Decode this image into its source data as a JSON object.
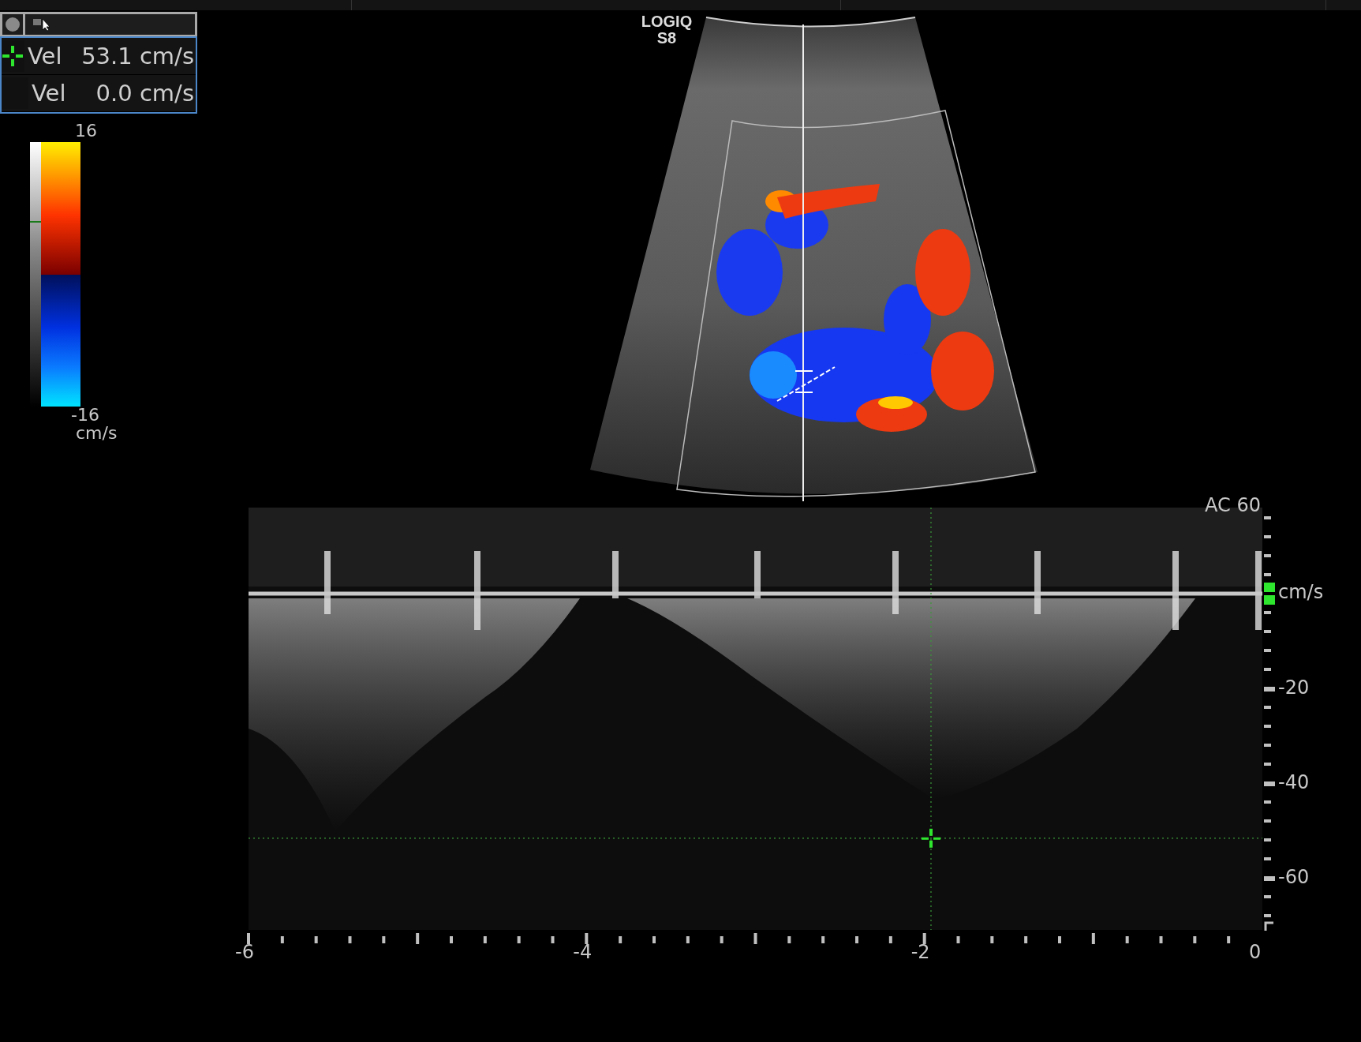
{
  "measurements": [
    {
      "label": "Vel",
      "value": "53.1 cm/s",
      "marker": true
    },
    {
      "label": "Vel",
      "value": "0.0 cm/s",
      "marker": false
    }
  ],
  "color_scale": {
    "max": "16",
    "min": "-16",
    "unit": "cm/s"
  },
  "system_label": {
    "line_1": "LOGIQ",
    "line_2": "S8"
  },
  "spectrum": {
    "ac_label": "AC 60",
    "y_unit": "cm/s",
    "y_ticks": [
      "-20",
      "-40",
      "-60"
    ],
    "x_ticks": [
      "-6",
      "-4",
      "-2",
      "0"
    ]
  }
}
